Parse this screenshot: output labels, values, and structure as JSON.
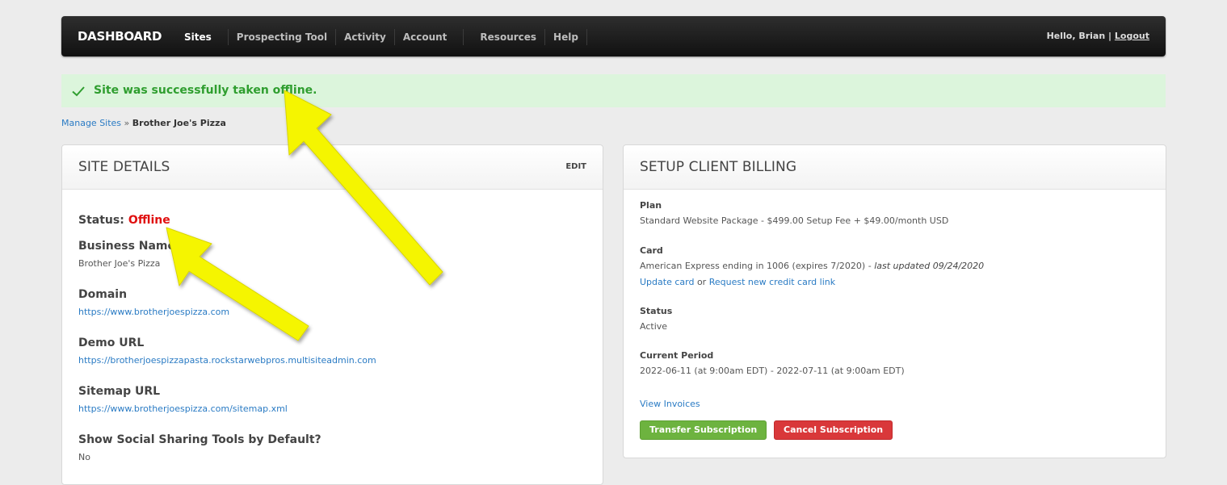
{
  "nav": {
    "brand": "DASHBOARD",
    "items": [
      "Sites",
      "Prospecting Tool",
      "Activity",
      "Account",
      "Resources",
      "Help"
    ],
    "greeting": "Hello, Brian",
    "separator": "|",
    "logout": "Logout"
  },
  "alert": {
    "message": "Site was successfully taken offline.",
    "icon": "check-icon",
    "color": "#2f9e2f"
  },
  "breadcrumb": {
    "link": "Manage Sites",
    "separator": "»",
    "current": "Brother Joe's Pizza"
  },
  "site_details": {
    "title": "SITE DETAILS",
    "edit": "EDIT",
    "status_label": "Status:",
    "status_value": "Offline",
    "status_color": "#e01010",
    "fields": [
      {
        "label": "Business Name",
        "value": "Brother Joe's Pizza"
      },
      {
        "label": "Domain",
        "value": "https://www.brotherjoespizza.com"
      },
      {
        "label": "Demo URL",
        "value": "https://brotherjoespizzapasta.rockstarwebpros.multisiteadmin.com"
      },
      {
        "label": "Sitemap URL",
        "value": "https://www.brotherjoespizza.com/sitemap.xml"
      },
      {
        "label": "Show Social Sharing Tools by Default?",
        "value": "No"
      }
    ]
  },
  "billing": {
    "title": "SETUP CLIENT BILLING",
    "plan_label": "Plan",
    "plan_value": "Standard Website Package - $499.00 Setup Fee + $49.00/month USD",
    "card_label": "Card",
    "card_value": "American Express ending in 1006 (expires 7/2020) -",
    "card_updated": "last updated 09/24/2020",
    "update_card": "Update card",
    "or": "or",
    "request_link": "Request new credit card link",
    "status_label": "Status",
    "status_value": "Active",
    "period_label": "Current Period",
    "period_value": "2022-06-11 (at 9:00am EDT) - 2022-07-11 (at 9:00am EDT)",
    "view_invoices": "View Invoices",
    "transfer_button": "Transfer Subscription",
    "cancel_button": "Cancel Subscription",
    "transfer_color": "#6db33f",
    "cancel_color": "#d9383a"
  },
  "annotation": {
    "arrow_color": "#f5f500"
  }
}
